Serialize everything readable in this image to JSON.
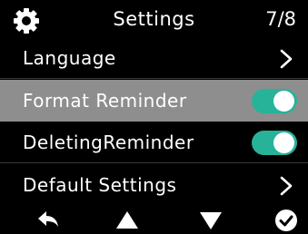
{
  "header": {
    "title": "Settings",
    "page": "7/8",
    "icon": "gear-icon"
  },
  "menu": [
    {
      "label": "Language",
      "control": "chevron",
      "selected": false
    },
    {
      "label": "Format Reminder",
      "control": "toggle",
      "on": true,
      "selected": true
    },
    {
      "label": "DeletingReminder",
      "control": "toggle",
      "on": true,
      "selected": false
    },
    {
      "label": "Default Settings",
      "control": "chevron",
      "selected": false
    }
  ],
  "bottom_bar": {
    "icons": [
      "back-icon",
      "up-arrow-icon",
      "down-arrow-icon",
      "confirm-check-icon"
    ]
  },
  "colors": {
    "background": "#000000",
    "selected_row": "#8e8e8e",
    "toggle_on": "#27b39a",
    "text": "#ffffff"
  }
}
